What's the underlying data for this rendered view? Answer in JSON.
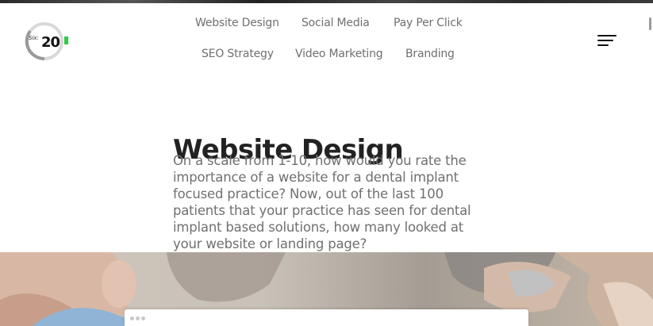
{
  "brand": {
    "logo_text": "Six:20",
    "accent_color": "#2ecc40"
  },
  "nav": {
    "row1": [
      "Website Design",
      "Social Media",
      "Pay Per Click"
    ],
    "row2": [
      "SEO Strategy",
      "Video Marketing",
      "Branding"
    ]
  },
  "main": {
    "title": "Website Design",
    "paragraph_lines": [
      "On a scale from 1-10, how would you rate the",
      "importance of a website for a dental implant",
      "focused practice? Now, out of the last 100",
      "patients that your practice has seen for dental",
      "implant based solutions, how many looked at",
      "your website or landing page?"
    ]
  },
  "icons": {
    "menu": "hamburger-menu-icon"
  },
  "colors": {
    "title": "#222222",
    "body": "#707070",
    "nav": "#6f6f6f"
  }
}
